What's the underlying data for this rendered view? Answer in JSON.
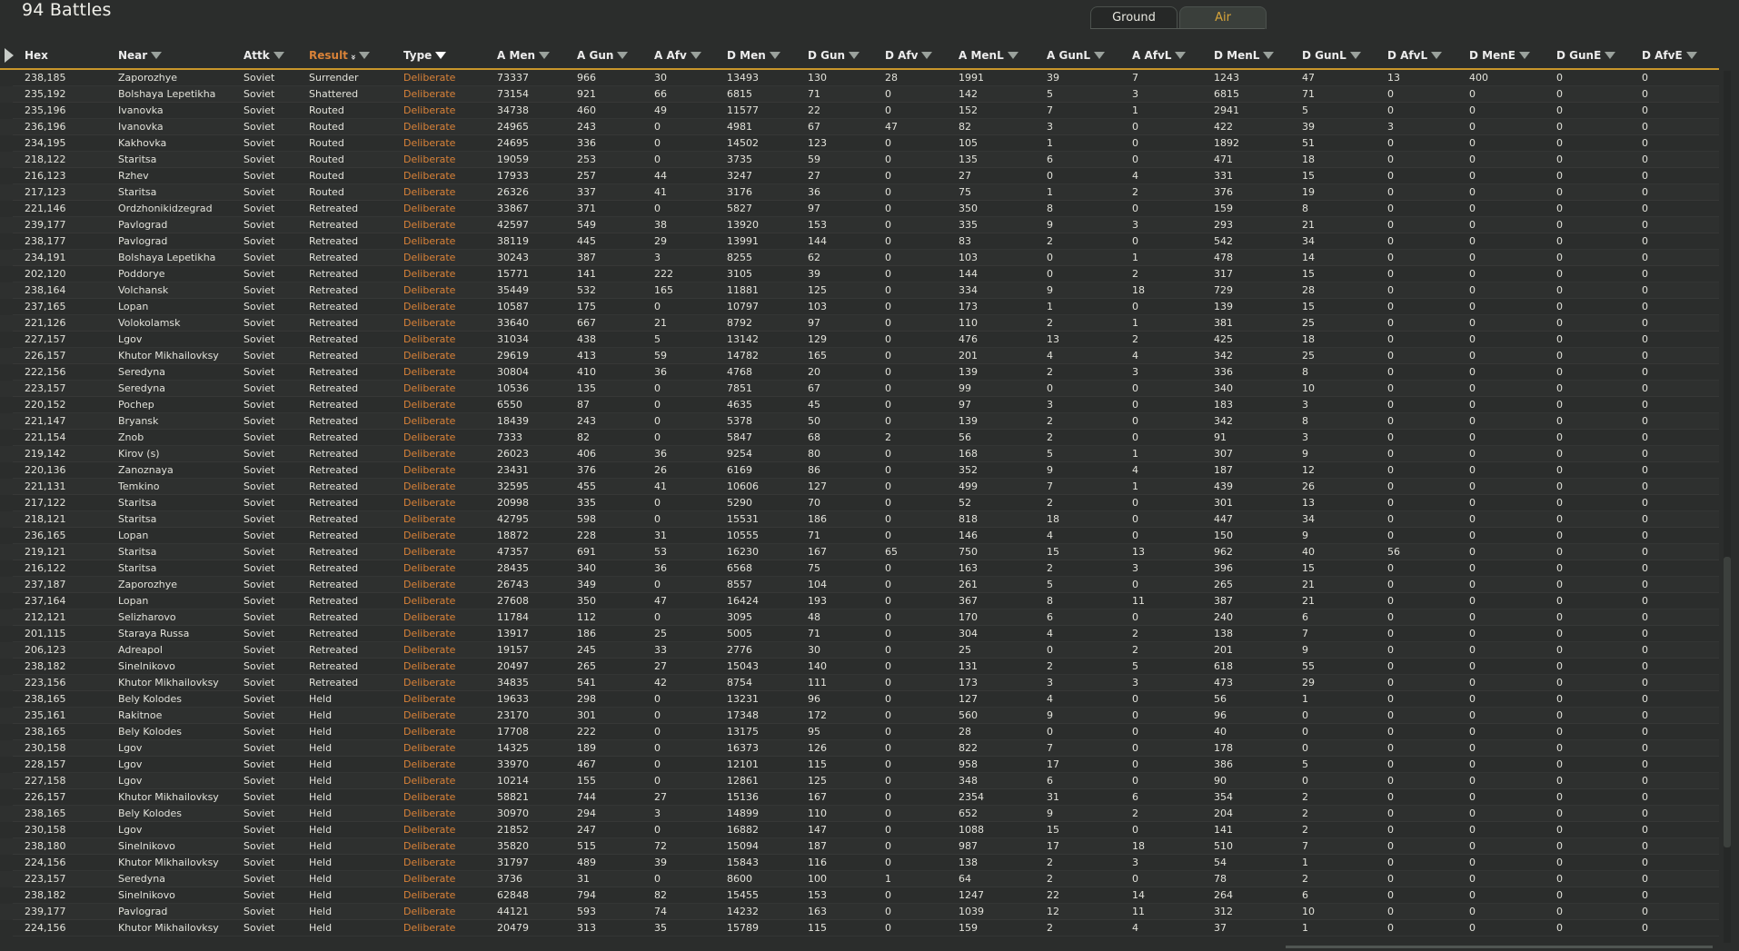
{
  "window": {
    "title": "94 Battles"
  },
  "tabs": [
    {
      "label": "Ground",
      "active": true
    },
    {
      "label": "Air",
      "active": false
    }
  ],
  "colors": {
    "accent": "#d98238",
    "header_line": "#c9962b",
    "background": "#2b2d2c"
  },
  "columns": [
    {
      "label": "Hex",
      "filter": false,
      "sorted": false
    },
    {
      "label": "Near",
      "filter": true,
      "sorted": false
    },
    {
      "label": "Attk",
      "filter": true,
      "sorted": false
    },
    {
      "label": "Result",
      "filter": true,
      "sorted": true,
      "sort_direction": "descending"
    },
    {
      "label": "Type",
      "filter": true,
      "filter_active": true,
      "sorted": false
    },
    {
      "label": "A Men",
      "filter": true,
      "sorted": false
    },
    {
      "label": "A Gun",
      "filter": true,
      "sorted": false
    },
    {
      "label": "A Afv",
      "filter": true,
      "sorted": false
    },
    {
      "label": "D Men",
      "filter": true,
      "sorted": false
    },
    {
      "label": "D Gun",
      "filter": true,
      "sorted": false
    },
    {
      "label": "D Afv",
      "filter": true,
      "sorted": false
    },
    {
      "label": "A MenL",
      "filter": true,
      "sorted": false
    },
    {
      "label": "A GunL",
      "filter": true,
      "sorted": false
    },
    {
      "label": "A AfvL",
      "filter": true,
      "sorted": false
    },
    {
      "label": "D MenL",
      "filter": true,
      "sorted": false
    },
    {
      "label": "D GunL",
      "filter": true,
      "sorted": false
    },
    {
      "label": "D AfvL",
      "filter": true,
      "sorted": false
    },
    {
      "label": "D MenE",
      "filter": true,
      "sorted": false
    },
    {
      "label": "D GunE",
      "filter": true,
      "sorted": false
    },
    {
      "label": "D AfvE",
      "filter": true,
      "sorted": false
    }
  ],
  "rows": [
    [
      "238,185",
      "Zaporozhye",
      "Soviet",
      "Surrender",
      "Deliberate",
      "73337",
      "966",
      "30",
      "13493",
      "130",
      "28",
      "1991",
      "39",
      "7",
      "1243",
      "47",
      "13",
      "400",
      "0",
      "0"
    ],
    [
      "235,192",
      "Bolshaya Lepetikha",
      "Soviet",
      "Shattered",
      "Deliberate",
      "73154",
      "921",
      "66",
      "6815",
      "71",
      "0",
      "142",
      "5",
      "3",
      "6815",
      "71",
      "0",
      "0",
      "0",
      "0"
    ],
    [
      "235,196",
      "Ivanovka",
      "Soviet",
      "Routed",
      "Deliberate",
      "34738",
      "460",
      "49",
      "11577",
      "22",
      "0",
      "152",
      "7",
      "1",
      "2941",
      "5",
      "0",
      "0",
      "0",
      "0"
    ],
    [
      "236,196",
      "Ivanovka",
      "Soviet",
      "Routed",
      "Deliberate",
      "24965",
      "243",
      "0",
      "4981",
      "67",
      "47",
      "82",
      "3",
      "0",
      "422",
      "39",
      "3",
      "0",
      "0",
      "0"
    ],
    [
      "234,195",
      "Kakhovka",
      "Soviet",
      "Routed",
      "Deliberate",
      "24695",
      "336",
      "0",
      "14502",
      "123",
      "0",
      "105",
      "1",
      "0",
      "1892",
      "51",
      "0",
      "0",
      "0",
      "0"
    ],
    [
      "218,122",
      "Staritsa",
      "Soviet",
      "Routed",
      "Deliberate",
      "19059",
      "253",
      "0",
      "3735",
      "59",
      "0",
      "135",
      "6",
      "0",
      "471",
      "18",
      "0",
      "0",
      "0",
      "0"
    ],
    [
      "216,123",
      "Rzhev",
      "Soviet",
      "Routed",
      "Deliberate",
      "17933",
      "257",
      "44",
      "3247",
      "27",
      "0",
      "27",
      "0",
      "4",
      "331",
      "15",
      "0",
      "0",
      "0",
      "0"
    ],
    [
      "217,123",
      "Staritsa",
      "Soviet",
      "Routed",
      "Deliberate",
      "26326",
      "337",
      "41",
      "3176",
      "36",
      "0",
      "75",
      "1",
      "2",
      "376",
      "19",
      "0",
      "0",
      "0",
      "0"
    ],
    [
      "221,146",
      "Ordzhonikidzegrad",
      "Soviet",
      "Retreated",
      "Deliberate",
      "33867",
      "371",
      "0",
      "5827",
      "97",
      "0",
      "350",
      "8",
      "0",
      "159",
      "8",
      "0",
      "0",
      "0",
      "0"
    ],
    [
      "239,177",
      "Pavlograd",
      "Soviet",
      "Retreated",
      "Deliberate",
      "42597",
      "549",
      "38",
      "13920",
      "153",
      "0",
      "335",
      "9",
      "3",
      "293",
      "21",
      "0",
      "0",
      "0",
      "0"
    ],
    [
      "238,177",
      "Pavlograd",
      "Soviet",
      "Retreated",
      "Deliberate",
      "38119",
      "445",
      "29",
      "13991",
      "144",
      "0",
      "83",
      "2",
      "0",
      "542",
      "34",
      "0",
      "0",
      "0",
      "0"
    ],
    [
      "234,191",
      "Bolshaya Lepetikha",
      "Soviet",
      "Retreated",
      "Deliberate",
      "30243",
      "387",
      "3",
      "8255",
      "62",
      "0",
      "103",
      "0",
      "1",
      "478",
      "14",
      "0",
      "0",
      "0",
      "0"
    ],
    [
      "202,120",
      "Poddorye",
      "Soviet",
      "Retreated",
      "Deliberate",
      "15771",
      "141",
      "222",
      "3105",
      "39",
      "0",
      "144",
      "0",
      "2",
      "317",
      "15",
      "0",
      "0",
      "0",
      "0"
    ],
    [
      "238,164",
      "Volchansk",
      "Soviet",
      "Retreated",
      "Deliberate",
      "35449",
      "532",
      "165",
      "11881",
      "125",
      "0",
      "334",
      "9",
      "18",
      "729",
      "28",
      "0",
      "0",
      "0",
      "0"
    ],
    [
      "237,165",
      "Lopan",
      "Soviet",
      "Retreated",
      "Deliberate",
      "10587",
      "175",
      "0",
      "10797",
      "103",
      "0",
      "173",
      "1",
      "0",
      "139",
      "15",
      "0",
      "0",
      "0",
      "0"
    ],
    [
      "221,126",
      "Volokolamsk",
      "Soviet",
      "Retreated",
      "Deliberate",
      "33640",
      "667",
      "21",
      "8792",
      "97",
      "0",
      "110",
      "2",
      "1",
      "381",
      "25",
      "0",
      "0",
      "0",
      "0"
    ],
    [
      "227,157",
      "Lgov",
      "Soviet",
      "Retreated",
      "Deliberate",
      "31034",
      "438",
      "5",
      "13142",
      "129",
      "0",
      "476",
      "13",
      "2",
      "425",
      "18",
      "0",
      "0",
      "0",
      "0"
    ],
    [
      "226,157",
      "Khutor Mikhailovksy",
      "Soviet",
      "Retreated",
      "Deliberate",
      "29619",
      "413",
      "59",
      "14782",
      "165",
      "0",
      "201",
      "4",
      "4",
      "342",
      "25",
      "0",
      "0",
      "0",
      "0"
    ],
    [
      "222,156",
      "Seredyna",
      "Soviet",
      "Retreated",
      "Deliberate",
      "30804",
      "410",
      "36",
      "4768",
      "20",
      "0",
      "139",
      "2",
      "3",
      "336",
      "8",
      "0",
      "0",
      "0",
      "0"
    ],
    [
      "223,157",
      "Seredyna",
      "Soviet",
      "Retreated",
      "Deliberate",
      "10536",
      "135",
      "0",
      "7851",
      "67",
      "0",
      "99",
      "0",
      "0",
      "340",
      "10",
      "0",
      "0",
      "0",
      "0"
    ],
    [
      "220,152",
      "Pochep",
      "Soviet",
      "Retreated",
      "Deliberate",
      "6550",
      "87",
      "0",
      "4635",
      "45",
      "0",
      "97",
      "3",
      "0",
      "183",
      "3",
      "0",
      "0",
      "0",
      "0"
    ],
    [
      "221,147",
      "Bryansk",
      "Soviet",
      "Retreated",
      "Deliberate",
      "18439",
      "243",
      "0",
      "5378",
      "50",
      "0",
      "139",
      "2",
      "0",
      "342",
      "8",
      "0",
      "0",
      "0",
      "0"
    ],
    [
      "221,154",
      "Znob",
      "Soviet",
      "Retreated",
      "Deliberate",
      "7333",
      "82",
      "0",
      "5847",
      "68",
      "2",
      "56",
      "2",
      "0",
      "91",
      "3",
      "0",
      "0",
      "0",
      "0"
    ],
    [
      "219,142",
      "Kirov (s)",
      "Soviet",
      "Retreated",
      "Deliberate",
      "26023",
      "406",
      "36",
      "9254",
      "80",
      "0",
      "168",
      "5",
      "1",
      "307",
      "9",
      "0",
      "0",
      "0",
      "0"
    ],
    [
      "220,136",
      "Zanoznaya",
      "Soviet",
      "Retreated",
      "Deliberate",
      "23431",
      "376",
      "26",
      "6169",
      "86",
      "0",
      "352",
      "9",
      "4",
      "187",
      "12",
      "0",
      "0",
      "0",
      "0"
    ],
    [
      "221,131",
      "Temkino",
      "Soviet",
      "Retreated",
      "Deliberate",
      "32595",
      "455",
      "41",
      "10606",
      "127",
      "0",
      "499",
      "7",
      "1",
      "439",
      "26",
      "0",
      "0",
      "0",
      "0"
    ],
    [
      "217,122",
      "Staritsa",
      "Soviet",
      "Retreated",
      "Deliberate",
      "20998",
      "335",
      "0",
      "5290",
      "70",
      "0",
      "52",
      "2",
      "0",
      "301",
      "13",
      "0",
      "0",
      "0",
      "0"
    ],
    [
      "218,121",
      "Staritsa",
      "Soviet",
      "Retreated",
      "Deliberate",
      "42795",
      "598",
      "0",
      "15531",
      "186",
      "0",
      "818",
      "18",
      "0",
      "447",
      "34",
      "0",
      "0",
      "0",
      "0"
    ],
    [
      "236,165",
      "Lopan",
      "Soviet",
      "Retreated",
      "Deliberate",
      "18872",
      "228",
      "31",
      "10555",
      "71",
      "0",
      "146",
      "4",
      "0",
      "150",
      "9",
      "0",
      "0",
      "0",
      "0"
    ],
    [
      "219,121",
      "Staritsa",
      "Soviet",
      "Retreated",
      "Deliberate",
      "47357",
      "691",
      "53",
      "16230",
      "167",
      "65",
      "750",
      "15",
      "13",
      "962",
      "40",
      "56",
      "0",
      "0",
      "0"
    ],
    [
      "216,122",
      "Staritsa",
      "Soviet",
      "Retreated",
      "Deliberate",
      "28435",
      "340",
      "36",
      "6568",
      "75",
      "0",
      "163",
      "2",
      "3",
      "396",
      "15",
      "0",
      "0",
      "0",
      "0"
    ],
    [
      "237,187",
      "Zaporozhye",
      "Soviet",
      "Retreated",
      "Deliberate",
      "26743",
      "349",
      "0",
      "8557",
      "104",
      "0",
      "261",
      "5",
      "0",
      "265",
      "21",
      "0",
      "0",
      "0",
      "0"
    ],
    [
      "237,164",
      "Lopan",
      "Soviet",
      "Retreated",
      "Deliberate",
      "27608",
      "350",
      "47",
      "16424",
      "193",
      "0",
      "367",
      "8",
      "11",
      "387",
      "21",
      "0",
      "0",
      "0",
      "0"
    ],
    [
      "212,121",
      "Selizharovo",
      "Soviet",
      "Retreated",
      "Deliberate",
      "11784",
      "112",
      "0",
      "3095",
      "48",
      "0",
      "170",
      "6",
      "0",
      "240",
      "6",
      "0",
      "0",
      "0",
      "0"
    ],
    [
      "201,115",
      "Staraya Russa",
      "Soviet",
      "Retreated",
      "Deliberate",
      "13917",
      "186",
      "25",
      "5005",
      "71",
      "0",
      "304",
      "4",
      "2",
      "138",
      "7",
      "0",
      "0",
      "0",
      "0"
    ],
    [
      "206,123",
      "Adreapol",
      "Soviet",
      "Retreated",
      "Deliberate",
      "19157",
      "245",
      "33",
      "2776",
      "30",
      "0",
      "25",
      "0",
      "2",
      "201",
      "9",
      "0",
      "0",
      "0",
      "0"
    ],
    [
      "238,182",
      "Sinelnikovo",
      "Soviet",
      "Retreated",
      "Deliberate",
      "20497",
      "265",
      "27",
      "15043",
      "140",
      "0",
      "131",
      "2",
      "5",
      "618",
      "55",
      "0",
      "0",
      "0",
      "0"
    ],
    [
      "223,156",
      "Khutor Mikhailovksy",
      "Soviet",
      "Retreated",
      "Deliberate",
      "34835",
      "541",
      "42",
      "8754",
      "111",
      "0",
      "173",
      "3",
      "3",
      "473",
      "29",
      "0",
      "0",
      "0",
      "0"
    ],
    [
      "238,165",
      "Bely Kolodes",
      "Soviet",
      "Held",
      "Deliberate",
      "19633",
      "298",
      "0",
      "13231",
      "96",
      "0",
      "127",
      "4",
      "0",
      "56",
      "1",
      "0",
      "0",
      "0",
      "0"
    ],
    [
      "235,161",
      "Rakitnoe",
      "Soviet",
      "Held",
      "Deliberate",
      "23170",
      "301",
      "0",
      "17348",
      "172",
      "0",
      "560",
      "9",
      "0",
      "96",
      "0",
      "0",
      "0",
      "0",
      "0"
    ],
    [
      "238,165",
      "Bely Kolodes",
      "Soviet",
      "Held",
      "Deliberate",
      "17708",
      "222",
      "0",
      "13175",
      "95",
      "0",
      "28",
      "0",
      "0",
      "40",
      "0",
      "0",
      "0",
      "0",
      "0"
    ],
    [
      "230,158",
      "Lgov",
      "Soviet",
      "Held",
      "Deliberate",
      "14325",
      "189",
      "0",
      "16373",
      "126",
      "0",
      "822",
      "7",
      "0",
      "178",
      "0",
      "0",
      "0",
      "0",
      "0"
    ],
    [
      "228,157",
      "Lgov",
      "Soviet",
      "Held",
      "Deliberate",
      "33970",
      "467",
      "0",
      "12101",
      "115",
      "0",
      "958",
      "17",
      "0",
      "386",
      "5",
      "0",
      "0",
      "0",
      "0"
    ],
    [
      "227,158",
      "Lgov",
      "Soviet",
      "Held",
      "Deliberate",
      "10214",
      "155",
      "0",
      "12861",
      "125",
      "0",
      "348",
      "6",
      "0",
      "90",
      "0",
      "0",
      "0",
      "0",
      "0"
    ],
    [
      "226,157",
      "Khutor Mikhailovksy",
      "Soviet",
      "Held",
      "Deliberate",
      "58821",
      "744",
      "27",
      "15136",
      "167",
      "0",
      "2354",
      "31",
      "6",
      "354",
      "2",
      "0",
      "0",
      "0",
      "0"
    ],
    [
      "238,165",
      "Bely Kolodes",
      "Soviet",
      "Held",
      "Deliberate",
      "30970",
      "294",
      "3",
      "14899",
      "110",
      "0",
      "652",
      "9",
      "2",
      "204",
      "2",
      "0",
      "0",
      "0",
      "0"
    ],
    [
      "230,158",
      "Lgov",
      "Soviet",
      "Held",
      "Deliberate",
      "21852",
      "247",
      "0",
      "16882",
      "147",
      "0",
      "1088",
      "15",
      "0",
      "141",
      "2",
      "0",
      "0",
      "0",
      "0"
    ],
    [
      "238,180",
      "Sinelnikovo",
      "Soviet",
      "Held",
      "Deliberate",
      "35820",
      "515",
      "72",
      "15094",
      "187",
      "0",
      "987",
      "17",
      "18",
      "510",
      "7",
      "0",
      "0",
      "0",
      "0"
    ],
    [
      "224,156",
      "Khutor Mikhailovksy",
      "Soviet",
      "Held",
      "Deliberate",
      "31797",
      "489",
      "39",
      "15843",
      "116",
      "0",
      "138",
      "2",
      "3",
      "54",
      "1",
      "0",
      "0",
      "0",
      "0"
    ],
    [
      "223,157",
      "Seredyna",
      "Soviet",
      "Held",
      "Deliberate",
      "3736",
      "31",
      "0",
      "8600",
      "100",
      "1",
      "64",
      "2",
      "0",
      "78",
      "2",
      "0",
      "0",
      "0",
      "0"
    ],
    [
      "238,182",
      "Sinelnikovo",
      "Soviet",
      "Held",
      "Deliberate",
      "62848",
      "794",
      "82",
      "15455",
      "153",
      "0",
      "1247",
      "22",
      "14",
      "264",
      "6",
      "0",
      "0",
      "0",
      "0"
    ],
    [
      "239,177",
      "Pavlograd",
      "Soviet",
      "Held",
      "Deliberate",
      "44121",
      "593",
      "74",
      "14232",
      "163",
      "0",
      "1039",
      "12",
      "11",
      "312",
      "10",
      "0",
      "0",
      "0",
      "0"
    ],
    [
      "224,156",
      "Khutor Mikhailovksy",
      "Soviet",
      "Held",
      "Deliberate",
      "20479",
      "313",
      "35",
      "15789",
      "115",
      "0",
      "159",
      "2",
      "4",
      "37",
      "1",
      "0",
      "0",
      "0",
      "0"
    ]
  ]
}
